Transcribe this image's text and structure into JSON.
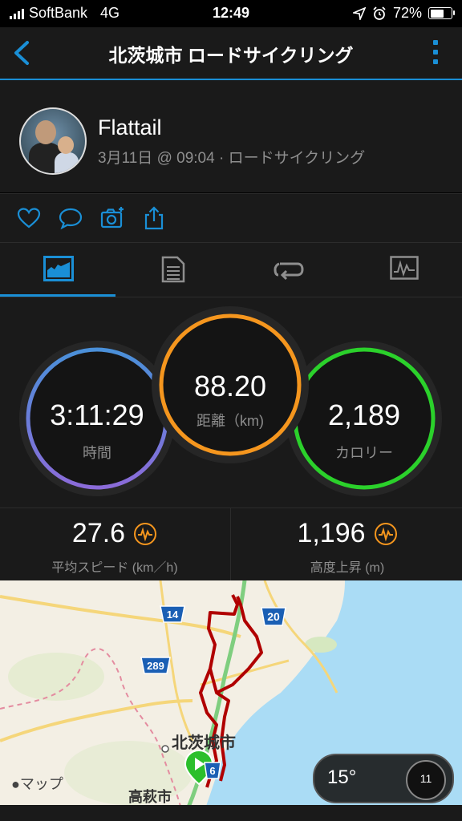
{
  "status_bar": {
    "carrier": "SoftBank",
    "network": "4G",
    "time": "12:49",
    "battery": "72%",
    "battery_level": 0.72
  },
  "nav": {
    "title": "北茨城市 ロードサイクリング"
  },
  "activity": {
    "user_name": "Flattail",
    "meta": "3月11日 @ 09:04 · ロードサイクリング"
  },
  "summary": {
    "time_value": "3:11:29",
    "time_label": "時間",
    "distance_value": "88.20",
    "distance_label": "距離（km)",
    "calories_value": "2,189",
    "calories_label": "カロリー"
  },
  "stats": {
    "avg_speed_value": "27.6",
    "avg_speed_label": "平均スピード (km／h)",
    "elevation_value": "1,196",
    "elevation_label": "高度上昇 (m)"
  },
  "map": {
    "road_14": "14",
    "road_20": "20",
    "road_289": "289",
    "road_6": "6",
    "city_label": "北茨城市",
    "city2_label": "高萩市",
    "attribution": "マップ",
    "temperature": "15°",
    "wind": "11"
  },
  "colors": {
    "accent": "#1a8fd6",
    "time_ring": "#4a90d9",
    "distance_ring": "#f5961e",
    "calories_ring": "#2bd12b",
    "route": "#b00000"
  }
}
